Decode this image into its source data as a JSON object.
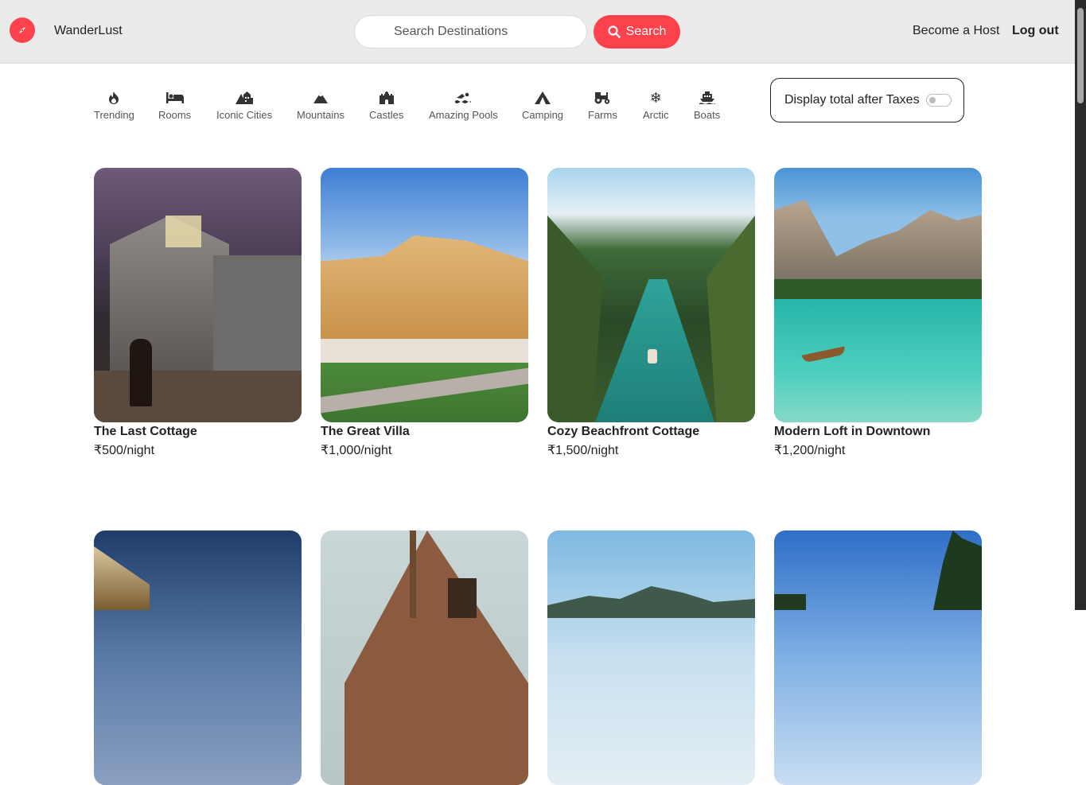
{
  "navbar": {
    "brand": "WanderLust",
    "logo_icon": "compass-icon",
    "search_placeholder": "Search Destinations",
    "search_button": "Search",
    "become_host": "Become a Host",
    "logout": "Log out",
    "accent_color": "#fe424d"
  },
  "filters": [
    {
      "label": "Trending",
      "icon": "fire-icon"
    },
    {
      "label": "Rooms",
      "icon": "bed-icon"
    },
    {
      "label": "Iconic Cities",
      "icon": "city-icon"
    },
    {
      "label": "Mountains",
      "icon": "mountain-icon"
    },
    {
      "label": "Castles",
      "icon": "castle-icon"
    },
    {
      "label": "Amazing Pools",
      "icon": "swimmer-icon"
    },
    {
      "label": "Camping",
      "icon": "tent-icon"
    },
    {
      "label": "Farms",
      "icon": "tractor-icon"
    },
    {
      "label": "Arctic",
      "icon": "snowflake-icon"
    },
    {
      "label": "Boats",
      "icon": "ship-icon"
    }
  ],
  "tax_toggle": {
    "label": "Display total after Taxes",
    "enabled": false
  },
  "listings": [
    {
      "title": "The Last Cottage",
      "price": "₹500/night",
      "image": "old stone house at dusk with dog"
    },
    {
      "title": "The Great Villa",
      "price": "₹1,000/night",
      "image": "ornate palace with gardens"
    },
    {
      "title": "Cozy Beachfront Cottage",
      "price": "₹1,500/night",
      "image": "palm-lined turquoise river with canoe"
    },
    {
      "title": "Modern Loft in Downtown",
      "price": "₹1,200/night",
      "image": "mountain lake with rowboat"
    },
    {
      "title": "",
      "price": "",
      "image": "lit building under dramatic sky"
    },
    {
      "title": "",
      "price": "",
      "image": "a-frame wooden cabin"
    },
    {
      "title": "",
      "price": "",
      "image": "tropical bay with cliffs"
    },
    {
      "title": "",
      "price": "",
      "image": "palm trees under blue sky"
    }
  ]
}
